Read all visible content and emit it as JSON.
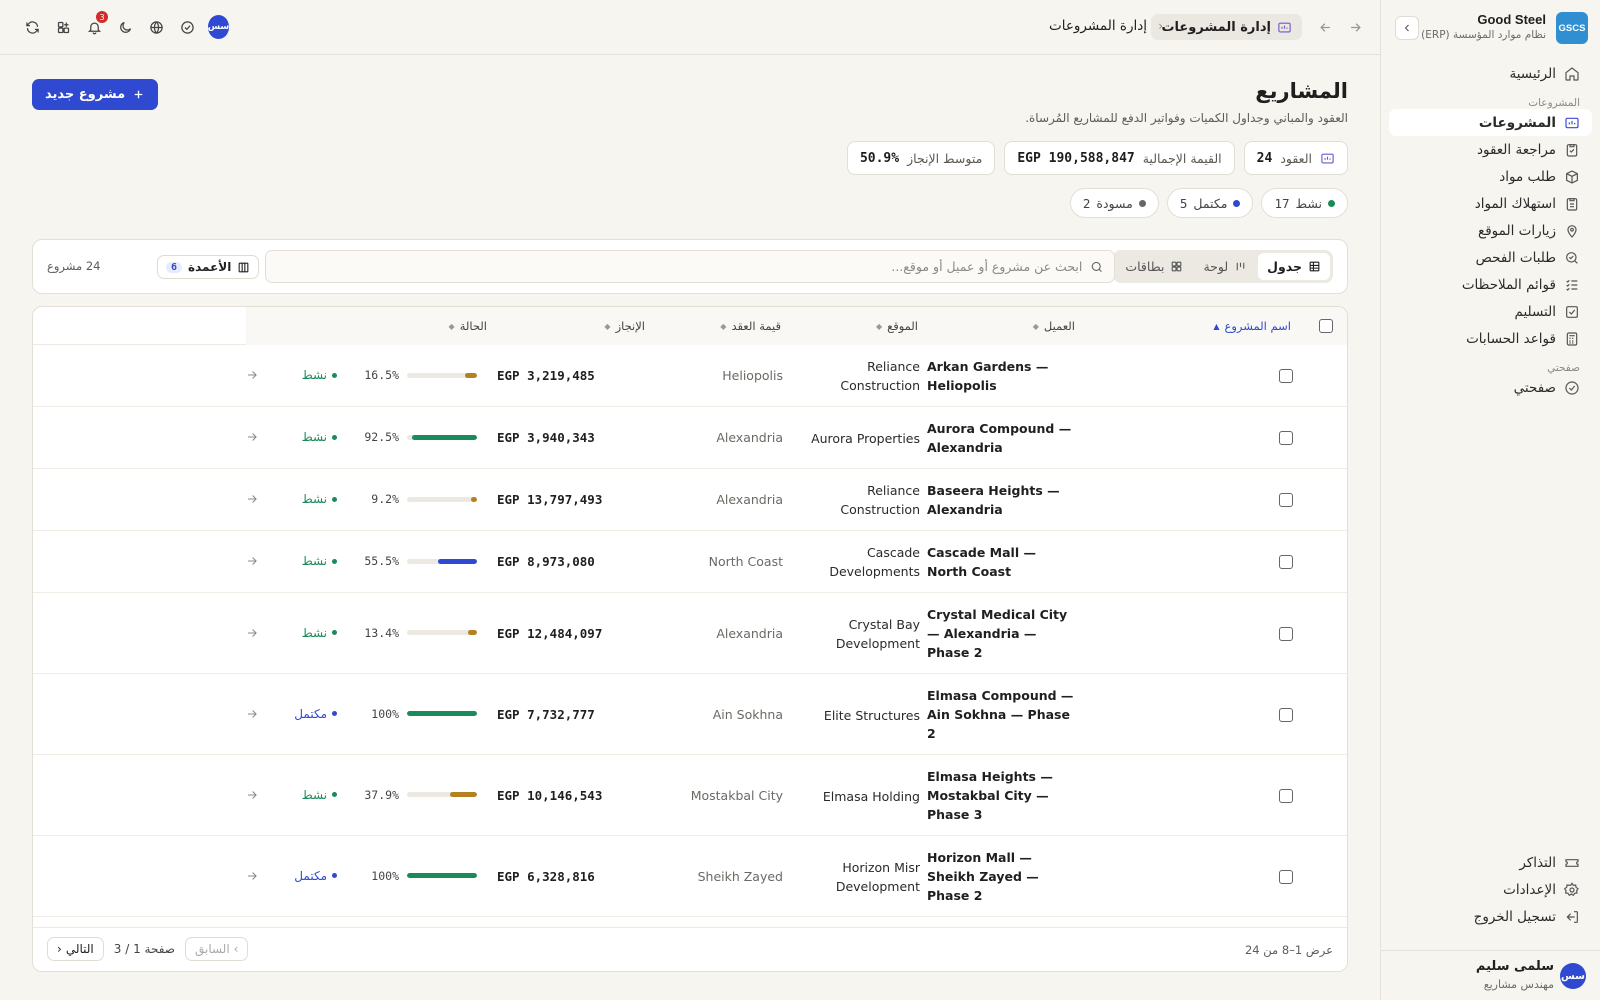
{
  "brand": {
    "logo": "GSCS",
    "name": "Good Steel",
    "subtitle": "نظام موارد المؤسسة (ERP)"
  },
  "sidebar": {
    "home": "الرئيسية",
    "section_projects": "المشروعات",
    "items": [
      {
        "label": "المشروعات",
        "icon": "folder-icon",
        "active": true
      },
      {
        "label": "مراجعة العقود",
        "icon": "clipboard-icon"
      },
      {
        "label": "طلب مواد",
        "icon": "package-icon"
      },
      {
        "label": "استهلاك المواد",
        "icon": "clipboard-list-icon"
      },
      {
        "label": "زيارات الموقع",
        "icon": "map-pin-icon"
      },
      {
        "label": "طلبات الفحص",
        "icon": "search-check-icon"
      },
      {
        "label": "قوائم الملاحظات",
        "icon": "list-check-icon"
      },
      {
        "label": "التسليم",
        "icon": "check-square-icon"
      },
      {
        "label": "قواعد الحسابات",
        "icon": "calculator-icon"
      }
    ],
    "section_verifier": "صفحتي",
    "verifier_item": "صفحتي",
    "bottom": {
      "tickets": "التذاكر",
      "settings": "الإعدادات",
      "logout": "تسجيل الخروج"
    },
    "user": {
      "initials": "سس",
      "name": "سلمى سليم",
      "role": "مهندس مشاريع"
    }
  },
  "topbar": {
    "breadcrumb_current": "إدارة المشروعات",
    "breadcrumb_parent": "إدارة المشروعات",
    "notifications_count": "3",
    "avatar_initials": "سس"
  },
  "page": {
    "title": "المشاريع",
    "subtitle": "العقود والمباني وجداول الكميات وفواتير الدفع للمشاريع المُرساة.",
    "new_button": "مشروع جديد"
  },
  "stats": {
    "contracts_label": "العقود",
    "contracts_value": "24",
    "total_label": "القيمة الإجمالية",
    "total_value": "EGP 190,588,847",
    "avg_label": "متوسط الإنجاز",
    "avg_value": "50.9%"
  },
  "filters": [
    {
      "label": "نشط",
      "count": "17",
      "color": "#1a8a5a"
    },
    {
      "label": "مكتمل",
      "count": "5",
      "color": "#2f4ad0"
    },
    {
      "label": "مسودة",
      "count": "2",
      "color": "#666666"
    }
  ],
  "toolbar": {
    "view_table": "جدول",
    "view_board": "لوحة",
    "view_cards": "بطاقات",
    "search_placeholder": "ابحث عن مشروع أو عميل أو موقع...",
    "columns_label": "الأعمدة",
    "columns_count": "6",
    "project_count": "24 مشروع"
  },
  "table": {
    "headers": {
      "name": "اسم المشروع",
      "client": "العميل",
      "site": "الموقع",
      "value": "قيمة العقد",
      "progress": "الإنجاز",
      "status": "الحالة"
    },
    "rows": [
      {
        "name": "Arkan Gardens — Heliopolis",
        "client": "Reliance Construction",
        "site": "Heliopolis",
        "value": "EGP 3,219,485",
        "progress": 16.5,
        "progress_label": "16.5%",
        "bar_color": "#b5801f",
        "status": "نشط",
        "status_color": "#1a8a5a"
      },
      {
        "name": "Aurora Compound — Alexandria",
        "client": "Aurora Properties",
        "site": "Alexandria",
        "value": "EGP 3,940,343",
        "progress": 92.5,
        "progress_label": "92.5%",
        "bar_color": "#1a8a5a",
        "status": "نشط",
        "status_color": "#1a8a5a"
      },
      {
        "name": "Baseera Heights — Alexandria",
        "client": "Reliance Construction",
        "site": "Alexandria",
        "value": "EGP 13,797,493",
        "progress": 9.2,
        "progress_label": "9.2%",
        "bar_color": "#b5801f",
        "status": "نشط",
        "status_color": "#1a8a5a"
      },
      {
        "name": "Cascade Mall — North Coast",
        "client": "Cascade Developments",
        "site": "North Coast",
        "value": "EGP 8,973,080",
        "progress": 55.5,
        "progress_label": "55.5%",
        "bar_color": "#2f4ad0",
        "status": "نشط",
        "status_color": "#1a8a5a"
      },
      {
        "name": "Crystal Medical City — Alexandria — Phase 2",
        "client": "Crystal Bay Development",
        "site": "Alexandria",
        "value": "EGP 12,484,097",
        "progress": 13.4,
        "progress_label": "13.4%",
        "bar_color": "#b5801f",
        "status": "نشط",
        "status_color": "#1a8a5a"
      },
      {
        "name": "Elmasa Compound — Ain Sokhna — Phase 2",
        "client": "Elite Structures",
        "site": "Ain Sokhna",
        "value": "EGP 7,732,777",
        "progress": 100,
        "progress_label": "100%",
        "bar_color": "#1a8a5a",
        "status": "مكتمل",
        "status_color": "#2f4ad0"
      },
      {
        "name": "Elmasa Heights — Mostakbal City — Phase 3",
        "client": "Elmasa Holding",
        "site": "Mostakbal City",
        "value": "EGP 10,146,543",
        "progress": 37.9,
        "progress_label": "37.9%",
        "bar_color": "#b5801f",
        "status": "نشط",
        "status_color": "#1a8a5a"
      },
      {
        "name": "Horizon Mall — Sheikh Zayed — Phase 2",
        "client": "Horizon Misr Development",
        "site": "Sheikh Zayed",
        "value": "EGP 6,328,816",
        "progress": 100,
        "progress_label": "100%",
        "bar_color": "#1a8a5a",
        "status": "مكتمل",
        "status_color": "#2f4ad0"
      }
    ]
  },
  "pagination": {
    "showing": "عرض 1–8 من 24",
    "prev": "السابق",
    "page_info": "صفحة 1 / 3",
    "next": "التالي"
  }
}
